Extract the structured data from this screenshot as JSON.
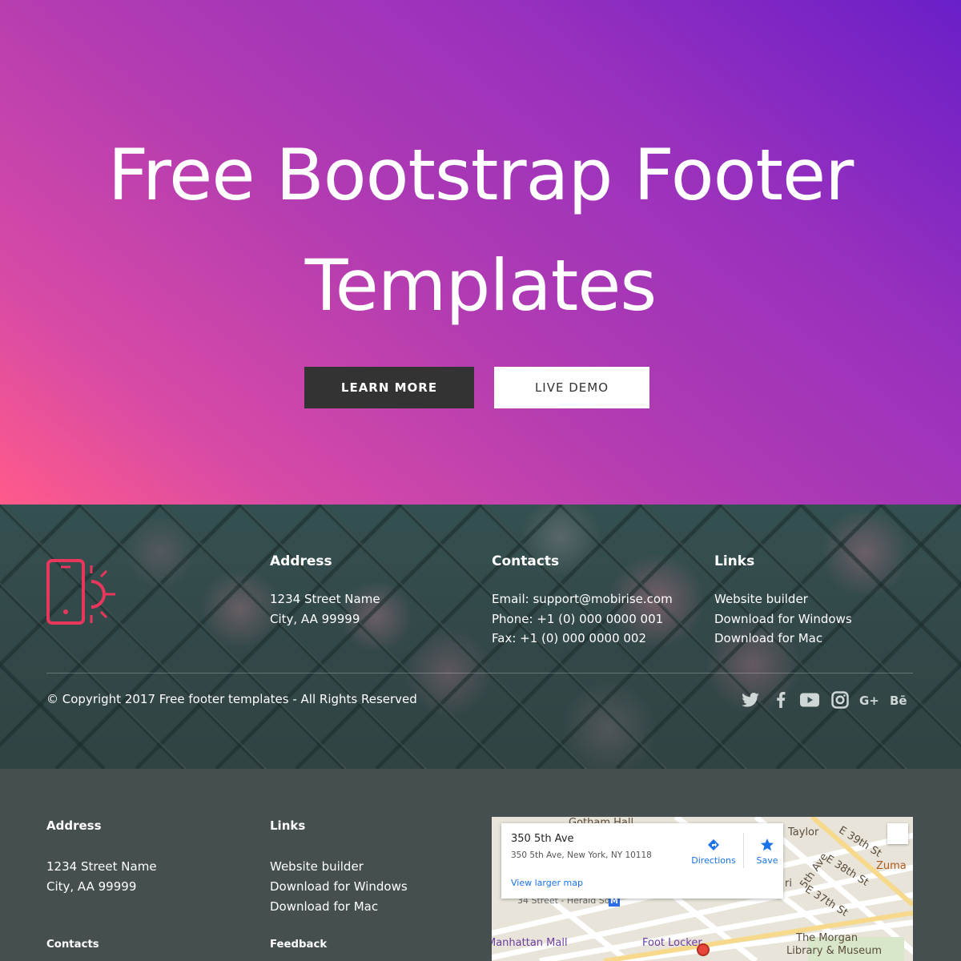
{
  "hero": {
    "title_line1": "Free Bootstrap Footer",
    "title_line2": "Templates",
    "learn_more": "LEARN MORE",
    "live_demo": "LIVE DEMO"
  },
  "footer1": {
    "logo": "phone-sun-icon",
    "address": {
      "heading": "Address",
      "line1": "1234 Street Name",
      "line2": "City, AA 99999"
    },
    "contacts": {
      "heading": "Contacts",
      "email": "Email: support@mobirise.com",
      "phone": "Phone: +1 (0) 000 0000 001",
      "fax": "Fax: +1 (0) 000 0000 002"
    },
    "links": {
      "heading": "Links",
      "items": [
        "Website builder",
        "Download for Windows",
        "Download for Mac"
      ]
    },
    "copyright": "© Copyright 2017 Free footer templates - All Rights Reserved",
    "social": [
      "twitter-icon",
      "facebook-icon",
      "youtube-icon",
      "instagram-icon",
      "google-plus-icon",
      "behance-icon"
    ]
  },
  "footer2": {
    "address": {
      "heading": "Address",
      "line1": "1234 Street Name",
      "line2": "City, AA 99999"
    },
    "links": {
      "heading": "Links",
      "items": [
        "Website builder",
        "Download for Windows",
        "Download for Mac"
      ]
    },
    "contacts_heading": "Contacts",
    "feedback_heading": "Feedback",
    "map": {
      "place": "350 5th Ave",
      "address": "350 5th Ave, New York, NY 10118",
      "directions": "Directions",
      "save": "Save",
      "larger_map": "View larger map",
      "labels": [
        "Gotham Hall",
        "Taylor",
        "E 39th St",
        "5th Ave",
        "E 38th St",
        "E 37th St",
        "Zuma",
        "34 Street - Herald Sq",
        "Foot Locker",
        "Manhattan Mall",
        "The Morgan",
        "Library & Museum",
        "ri"
      ]
    }
  },
  "colors": {
    "hero_start": "#ff5a8a",
    "hero_end": "#6a1fc8",
    "button_dark": "#333333",
    "footer2_bg": "#464f4f",
    "logo_accent": "#e8365d"
  }
}
